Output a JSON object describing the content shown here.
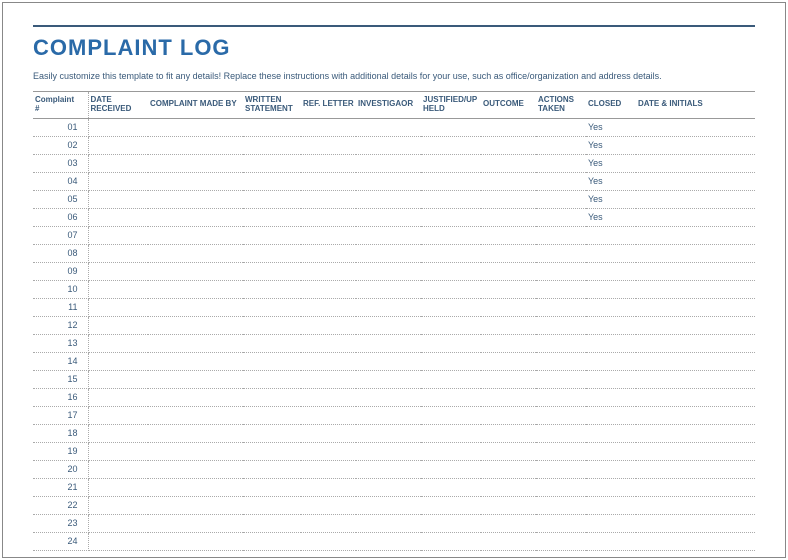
{
  "title": "COMPLAINT LOG",
  "instructions": "Easily customize this template to fit any details! Replace these instructions with additional details for your use, such as office/organization and address details.",
  "headers": {
    "complaint_num": "Complaint #",
    "date_received": "DATE RECEIVED",
    "made_by": "COMPLAINT MADE BY",
    "written": "WRITTEN STATEMENT",
    "ref_letter": "REF. LETTER",
    "investigator": "INVESTIGAOR",
    "justified": "JUSTIFIED/UP HELD",
    "outcome": "OUTCOME",
    "actions": "ACTIONS TAKEN",
    "closed": "CLOSED",
    "date_initials": "DATE & INITIALS"
  },
  "rows": [
    {
      "num": "01",
      "closed": "Yes"
    },
    {
      "num": "02",
      "closed": "Yes"
    },
    {
      "num": "03",
      "closed": "Yes"
    },
    {
      "num": "04",
      "closed": "Yes"
    },
    {
      "num": "05",
      "closed": "Yes"
    },
    {
      "num": "06",
      "closed": "Yes"
    },
    {
      "num": "07",
      "closed": ""
    },
    {
      "num": "08",
      "closed": ""
    },
    {
      "num": "09",
      "closed": ""
    },
    {
      "num": "10",
      "closed": ""
    },
    {
      "num": "11",
      "closed": ""
    },
    {
      "num": "12",
      "closed": ""
    },
    {
      "num": "13",
      "closed": ""
    },
    {
      "num": "14",
      "closed": ""
    },
    {
      "num": "15",
      "closed": ""
    },
    {
      "num": "16",
      "closed": ""
    },
    {
      "num": "17",
      "closed": ""
    },
    {
      "num": "18",
      "closed": ""
    },
    {
      "num": "19",
      "closed": ""
    },
    {
      "num": "20",
      "closed": ""
    },
    {
      "num": "21",
      "closed": ""
    },
    {
      "num": "22",
      "closed": ""
    },
    {
      "num": "23",
      "closed": ""
    },
    {
      "num": "24",
      "closed": ""
    }
  ]
}
